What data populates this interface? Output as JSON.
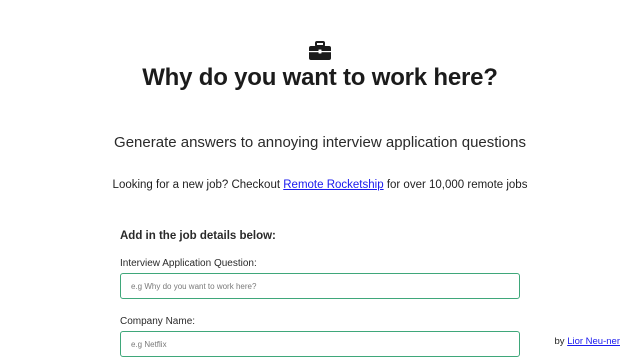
{
  "header": {
    "logo_icon": "briefcase-icon",
    "title": "Why do you want to work here?",
    "subtitle": "Generate answers to annoying interview application questions"
  },
  "promo": {
    "prefix": "Looking for a new job? Checkout",
    "link_text": "Remote Rocketship",
    "suffix": "for over 10,000 remote jobs"
  },
  "form": {
    "section_label": "Add in the job details below:",
    "question": {
      "label": "Interview Application Question:",
      "placeholder": "e.g Why do you want to work here?",
      "value": ""
    },
    "company": {
      "label": "Company Name:",
      "placeholder": "e.g Netflix",
      "value": ""
    }
  },
  "footer": {
    "credit_prefix": "by",
    "credit_link": "Lior Neu-ner"
  },
  "colors": {
    "link": "#1a1aee",
    "input_border": "#3fa77a",
    "title": "#1b1b1b"
  }
}
